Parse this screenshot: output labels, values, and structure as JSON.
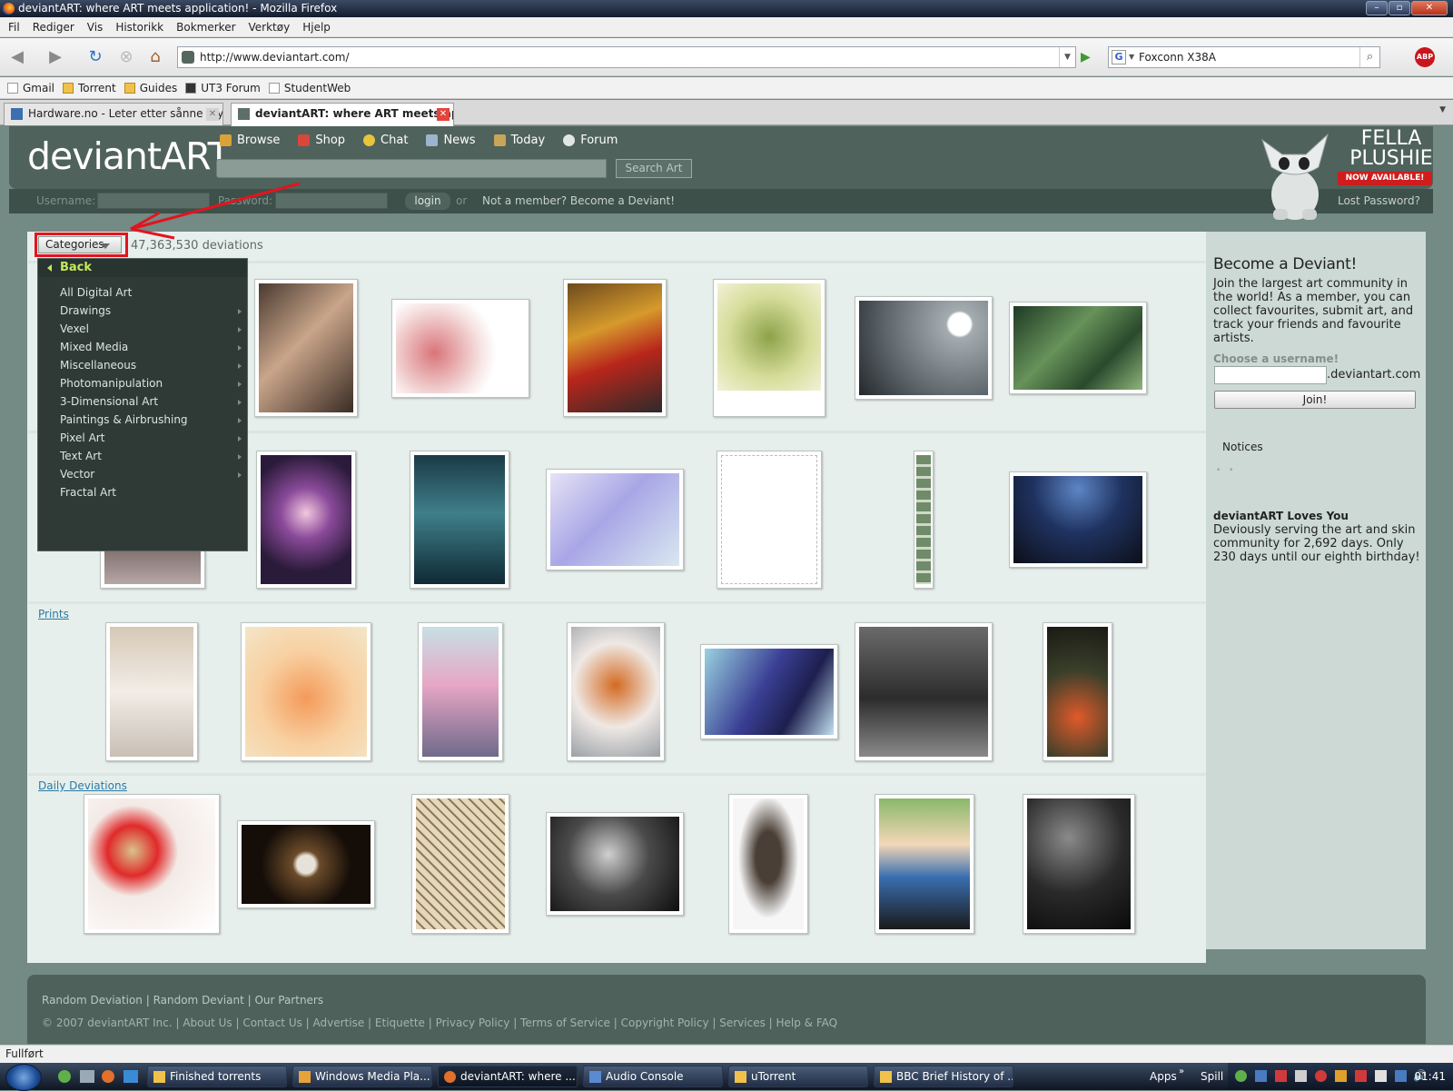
{
  "window": {
    "title": "deviantART: where ART meets application! - Mozilla Firefox"
  },
  "menu": [
    "Fil",
    "Rediger",
    "Vis",
    "Historikk",
    "Bokmerker",
    "Verktøy",
    "Hjelp"
  ],
  "nav": {
    "url": "http://www.deviantart.com/",
    "search": "Foxconn X38A",
    "abp": "ABP"
  },
  "bookmarks": [
    "Gmail",
    "Torrent",
    "Guides",
    "UT3 Forum",
    "StudentWeb"
  ],
  "tabs": [
    {
      "title": "Hardware.no - Leter etter sånne kry..."
    },
    {
      "title": "deviantART: where ART meets ap..."
    }
  ],
  "da": {
    "logo": "deviantART",
    "nav": [
      "Browse",
      "Shop",
      "Chat",
      "News",
      "Today",
      "Forum"
    ],
    "search_button": "Search Art",
    "login": {
      "username_label": "Username:",
      "password_label": "Password:",
      "login_button": "login",
      "or": "or",
      "not_member": "Not a member? Become a Deviant!",
      "lost_password": "Lost Password?"
    },
    "ad": {
      "line1": "FELLA",
      "line2": "PLUSHIE",
      "badge": "NOW AVAILABLE!"
    },
    "categories_button": "Categories",
    "deviations_count": "47,363,530 deviations",
    "category_menu": {
      "back": "Back",
      "items": [
        "All Digital Art",
        "Drawings",
        "Vexel",
        "Mixed Media",
        "Miscellaneous",
        "Photomanipulation",
        "3-Dimensional Art",
        "Paintings & Airbrushing",
        "Pixel Art",
        "Text Art",
        "Vector",
        "Fractal Art"
      ]
    },
    "sections": {
      "prints": "Prints",
      "daily": "Daily Deviations"
    },
    "sidebar": {
      "heading": "Become a Deviant!",
      "join_text": "Join the largest art community in the world! As a member, you can collect favourites, submit art, and track your friends and favourite artists.",
      "choose_label": "Choose a username!",
      "domain": ".deviantart.com",
      "join_button": "Join!",
      "notices": "Notices",
      "notices_dots": "• •",
      "loves_title": "deviantART Loves You",
      "loves_text": "Deviously serving the art and skin community for 2,692 days. Only 230 days until our eighth birthday!"
    },
    "footer": {
      "line1": "Random Deviation | Random Deviant | Our Partners",
      "line2": "© 2007 deviantART Inc. | About Us | Contact Us | Advertise | Etiquette | Privacy Policy | Terms of Service | Copyright Policy | Services | Help & FAQ"
    }
  },
  "status": "Fullført",
  "taskbar": {
    "items": [
      "Finished torrents",
      "Windows Media Pla...",
      "deviantART: where ...",
      "Audio Console",
      "uTorrent",
      "BBC Brief History of ..."
    ],
    "apps": "Apps",
    "spill": "Spill",
    "clock": "01:41"
  }
}
